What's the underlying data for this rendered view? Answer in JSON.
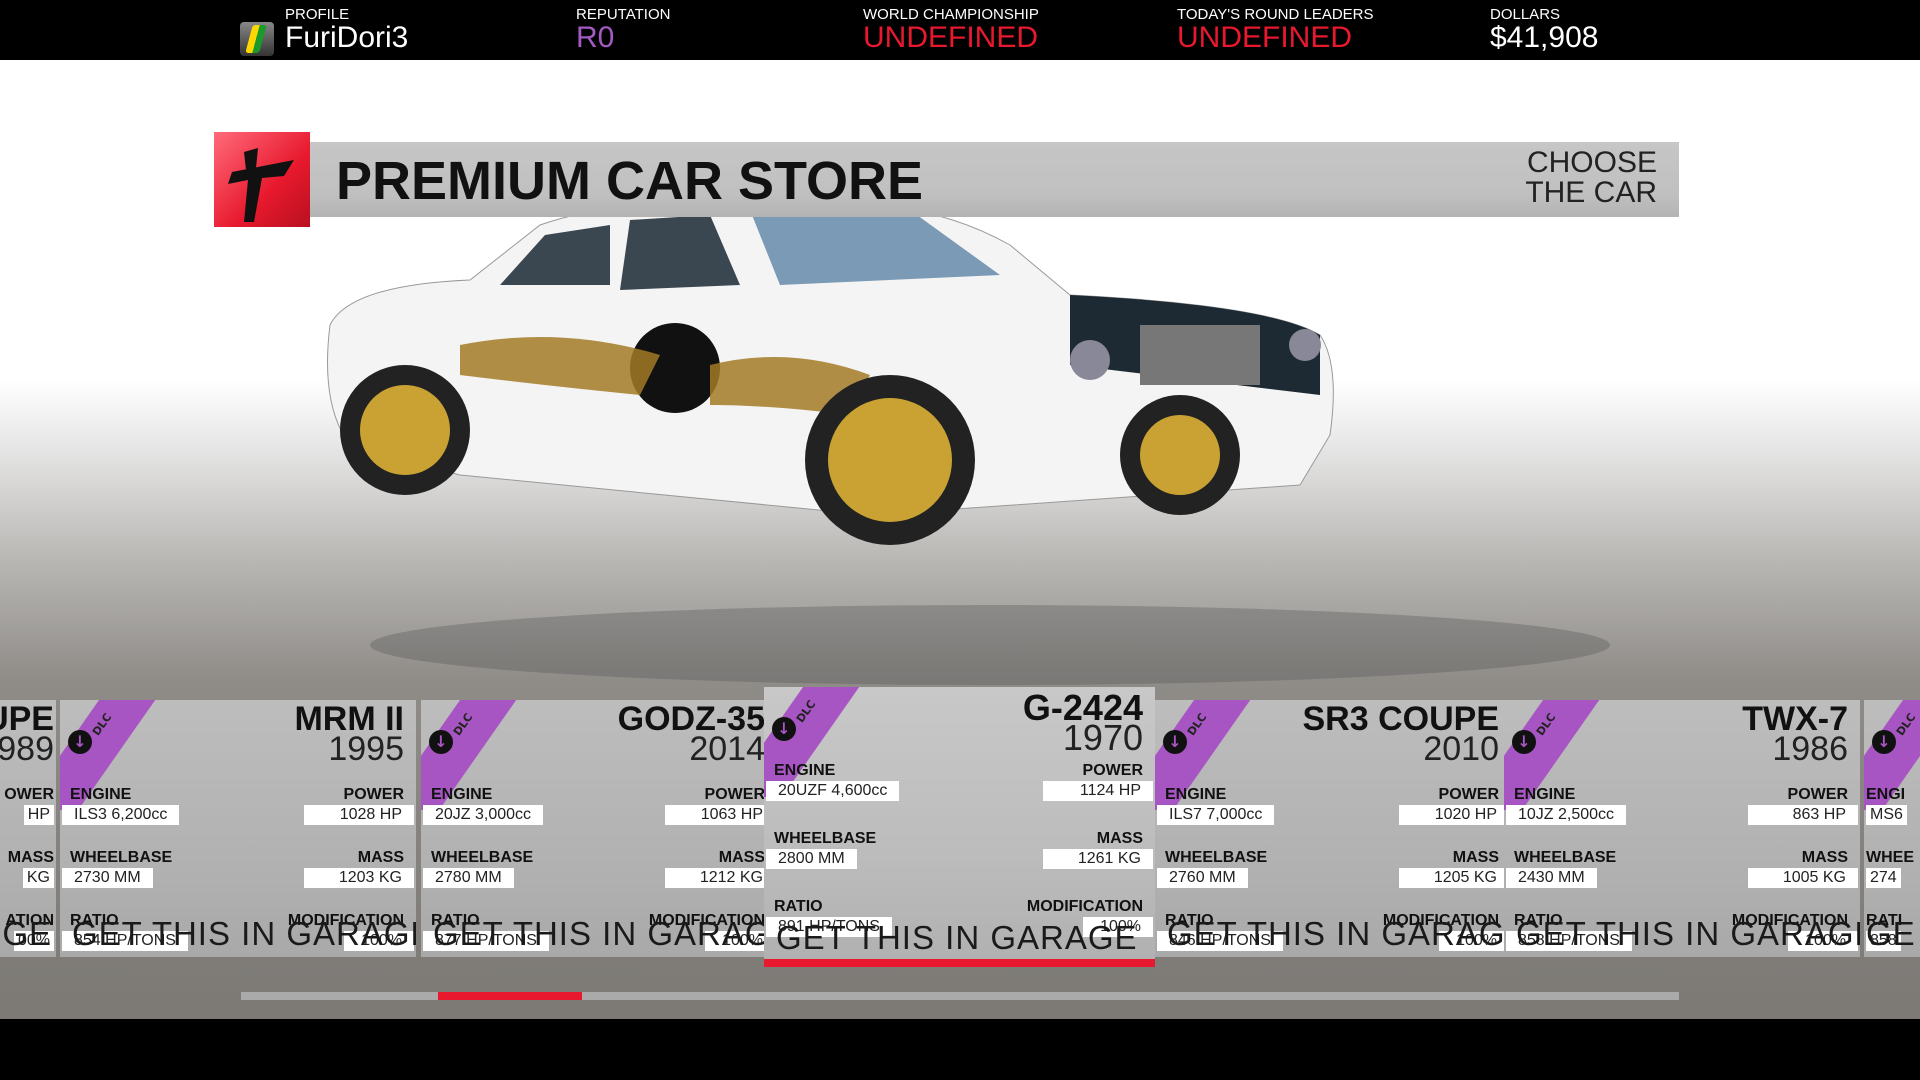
{
  "topbar": {
    "profile": {
      "label": "PROFILE",
      "value": "FuriDori3"
    },
    "reputation": {
      "label": "REPUTATION",
      "value": "R0",
      "color": "#a35bc1"
    },
    "world_championship": {
      "label": "WORLD CHAMPIONSHIP",
      "value": "UNDEFINED",
      "color": "#e8192e"
    },
    "round_leaders": {
      "label": "TODAY'S ROUND LEADERS",
      "value": "UNDEFINED",
      "color": "#e8192e"
    },
    "dollars": {
      "label": "DOLLARS",
      "value": "$41,908"
    }
  },
  "header": {
    "title": "PREMIUM CAR STORE",
    "subtitle_line1": "CHOOSE",
    "subtitle_line2": "THE CAR"
  },
  "colors": {
    "accent": "#e8192e",
    "dlc": "#a755c2"
  },
  "labels": {
    "engine": "ENGINE",
    "power": "POWER",
    "wheelbase": "WHEELBASE",
    "mass": "MASS",
    "ratio": "RATIO",
    "modification": "MODIFICATION",
    "get": "GET THIS IN GARAGE",
    "dlc": "DLC"
  },
  "cards": [
    {
      "partial": "left",
      "name": "UPE",
      "year": "989",
      "power": "HP",
      "mass": "KG",
      "modification": "00%",
      "get": "GE",
      "power_label": "OWER",
      "mass_label": "MASS",
      "modification_label": "ATION"
    },
    {
      "name": "MRM II",
      "year": "1995",
      "engine": "ILS3 6,200cc",
      "power": "1028 HP",
      "wheelbase": "2730 MM",
      "mass": "1203 KG",
      "ratio": "854 HP/TONS",
      "modification": "100%",
      "dlc": true
    },
    {
      "name": "GODZ-35",
      "year": "2014",
      "engine": "20JZ 3,000cc",
      "power": "1063 HP",
      "wheelbase": "2780 MM",
      "mass": "1212 KG",
      "ratio": "877 HP/TONS",
      "modification": "100%",
      "dlc": true
    },
    {
      "name": "G-2424",
      "year": "1970",
      "engine": "20UZF 4,600cc",
      "power": "1124 HP",
      "wheelbase": "2800 MM",
      "mass": "1261 KG",
      "ratio": "891 HP/TONS",
      "modification": "100%",
      "dlc": true,
      "selected": true
    },
    {
      "name": "SR3 COUPE",
      "year": "2010",
      "engine": "ILS7 7,000cc",
      "power": "1020 HP",
      "wheelbase": "2760 MM",
      "mass": "1205 KG",
      "ratio": "846 HP/TONS",
      "modification": "100%",
      "dlc": true
    },
    {
      "name": "TWX-7",
      "year": "1986",
      "engine": "10JZ 2,500cc",
      "power": "863 HP",
      "wheelbase": "2430 MM",
      "mass": "1005 KG",
      "ratio": "858 HP/TONS",
      "modification": "100%",
      "dlc": true
    },
    {
      "partial": "right",
      "engine_label": "ENGI",
      "engine": "MS6",
      "wheelbase_label": "WHEE",
      "wheelbase": "274",
      "ratio_label": "RATI",
      "ratio": "858",
      "get": "GE",
      "dlc": true
    }
  ],
  "scroll": {
    "position_fraction": 0.14,
    "visible_fraction": 0.1
  }
}
